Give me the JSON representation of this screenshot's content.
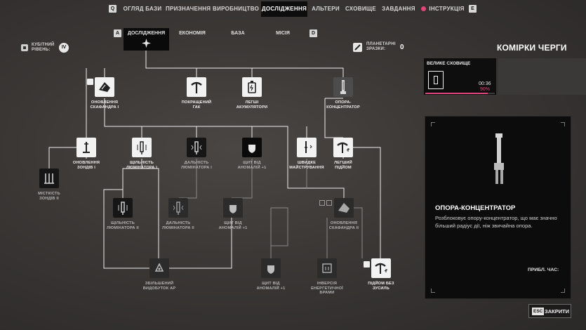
{
  "top_nav": {
    "left_key": "Q",
    "right_key": "E",
    "tabs": [
      {
        "label": "ОГЛЯД БАЗИ"
      },
      {
        "label": "ПРИЗНАЧЕННЯ"
      },
      {
        "label": "ВИРОБНИЦТВО"
      },
      {
        "label": "ДОСЛІДЖЕННЯ",
        "active": true
      },
      {
        "label": "АЛЬТЕРИ"
      },
      {
        "label": "СХОВИЩЕ"
      },
      {
        "label": "ЗАВДАННЯ"
      },
      {
        "label": "ІНСТРУКЦІЯ"
      }
    ]
  },
  "sub_nav": {
    "left_key": "A",
    "right_key": "D",
    "tabs": [
      {
        "label": "ДОСЛІДЖЕННЯ",
        "active": true
      },
      {
        "label": "ЕКОНОМІЯ"
      },
      {
        "label": "БАЗА"
      },
      {
        "label": "МІСІЯ"
      }
    ]
  },
  "cubic_level": {
    "label_line1": "КУБІТНИЙ",
    "label_line2": "РІВЕНЬ:",
    "value": "IV"
  },
  "planetary_samples": {
    "label_line1": "ПЛАНЕТАРНІ",
    "label_line2": "ЗРАЗКИ:",
    "value": "0"
  },
  "tree": {
    "row1": [
      {
        "line1": "ОНОВЛЕННЯ",
        "line2": "СКАФАНДРА I"
      },
      {
        "line1": "ПОКРАЩЕНИЙ",
        "line2": "ГАК"
      },
      {
        "line1": "ЛЕГШІ",
        "line2": "АКУМУЛЯТОРИ"
      },
      {
        "line1": "ОПОРА-",
        "line2": "КОНЦЕНТРАТОР"
      }
    ],
    "row2": [
      {
        "line1": "ОНОВЛЕННЯ",
        "line2": "ЗОНДІВ I"
      },
      {
        "line1": "ЩІЛЬНІСТЬ",
        "line2": "ЛЮМІНАТОРА I"
      },
      {
        "line1": "ДАЛЬНІСТЬ",
        "line2": "ЛЮМІНАТОРА I"
      },
      {
        "line1": "ЩИТ ВІД",
        "line2": "АНОМАЛІЙ +1"
      },
      {
        "line1": "ШВИДКЕ",
        "line2": "МАЙСТРУВАННЯ"
      },
      {
        "line1": "ЛЕГШИЙ",
        "line2": "ПІДЙОМ"
      }
    ],
    "row3": [
      {
        "line1": "МІСТКІСТЬ",
        "line2": "ЗОНДІВ II"
      }
    ],
    "row4": [
      {
        "line1": "ЩІЛЬНІСТЬ",
        "line2": "ЛЮМІНАТОРА II"
      },
      {
        "line1": "ДАЛЬНІСТЬ",
        "line2": "ЛЮМІНАТОРА II"
      },
      {
        "line1": "ЩИТ ВІД",
        "line2": "АНОМАЛІЙ +1"
      },
      {
        "line1": "ОНОВЛЕННЯ",
        "line2": "СКАФАНДРА II"
      }
    ],
    "row5": [
      {
        "line1": "ЗБІЛЬШЕНИЙ",
        "line2": "ВИДОБУТОК AP"
      },
      {
        "line1": "ЩИТ ВІД",
        "line2": "АНОМАЛІЙ +1"
      },
      {
        "line1": "ІНВЕРСІЯ",
        "line2": "ЕНЕРГЕТИЧНОЇ",
        "line3": "БРАМИ"
      },
      {
        "line1": "ПІДЙОМ БЕЗ",
        "line2": "ЗУСИЛЬ"
      }
    ]
  },
  "queue": {
    "title": "КОМІРКИ ЧЕРГИ",
    "item_name": "ВЕЛИКЕ СХОВИЩЕ",
    "time": "00:36",
    "percent": "90%",
    "progress": 0.9,
    "accent_color": "#e0457b"
  },
  "detail": {
    "title": "ОПОРА-КОНЦЕНТРАТОР",
    "description": "Розблоковує опору-концентратор, що має значно більший радіус дії, ніж звичайна опора.",
    "approx_time_label": "ПРИБЛ. ЧАС:"
  },
  "close_button": {
    "key": "ESC",
    "label": "ЗАКРИТИ"
  }
}
